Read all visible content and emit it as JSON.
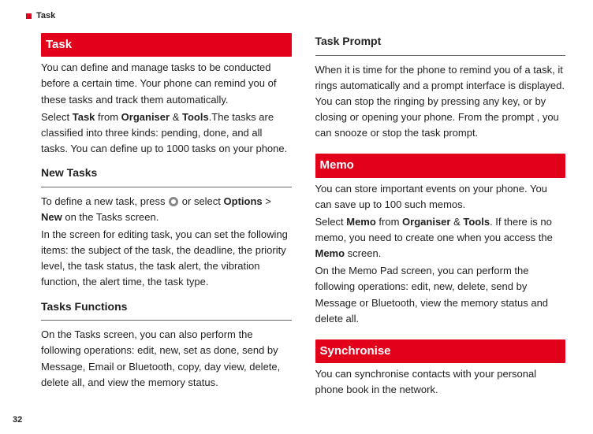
{
  "top_marker": "Task",
  "page_number": "32",
  "left": {
    "header1": "Task",
    "intro_text": "You can define and manage tasks to be conducted before a certain time. Your phone can remind you of these tasks and track them automatically.",
    "select_prefix": "Select ",
    "task_label": "Task",
    "select_mid1": " from ",
    "organiser_label": "Organiser",
    "amp": " & ",
    "tools_label": "Tools",
    "select_suffix": ".The tasks are classified into three kinds: pending, done, and all tasks. You can define up to 1000 tasks on your phone.",
    "sub1": "New Tasks",
    "newtask_prefix": "To define a new task, press ",
    "newtask_mid": " or select ",
    "options_label": "Options",
    "gt": " > ",
    "new_label": "New",
    "newtask_suffix": " on the Tasks screen.",
    "edit_text": "In the screen for editing task, you can set the following items: the subject of the task, the deadline, the priority level, the task status, the task alert, the vibration function, the alert time, the task type.",
    "sub2": "Tasks  Functions",
    "functions_text": "On the Tasks screen, you can also perform the following operations: edit, new, set as done, send by Message, Email or Bluetooth, copy, day view, delete, delete all, and view the memory status."
  },
  "right": {
    "sub1": "Task Prompt",
    "prompt_text": "When it is time for the phone to remind you of a task, it rings automatically and a prompt interface is displayed. You can stop the ringing by pressing any key, or by closing or opening your phone. From the prompt , you can snooze or stop the task prompt.",
    "header2": "Memo",
    "memo_intro": "You can store important events on your phone. You can save up to 100 such memos.",
    "memo_select_prefix": "Select ",
    "memo_label": "Memo",
    "memo_select_mid1": " from ",
    "organiser_label": "Organiser",
    "amp": " & ",
    "tools_label": "Tools",
    "memo_select_suffix": ". If there is no memo, you need to create one when you access the ",
    "memo_screen_label": "Memo",
    "memo_screen_suffix": " screen.",
    "memo_ops": "On the Memo Pad screen, you can perform the following operations: edit, new, delete, send by Message or Bluetooth, view the memory status and delete all.",
    "header3": "Synchronise",
    "sync_text": "You can synchronise contacts with your personal phone book in the network."
  }
}
